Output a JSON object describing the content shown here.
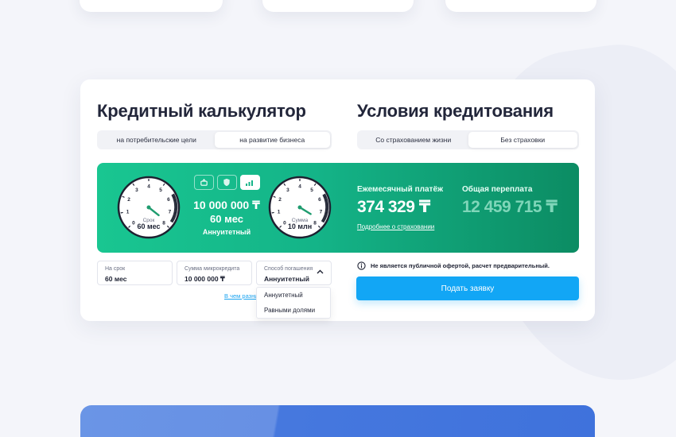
{
  "calculator": {
    "title": "Кредитный калькулятор",
    "purpose_tabs": [
      {
        "label": "на потребительские цели",
        "active": false
      },
      {
        "label": "на развитие бизнеса",
        "active": true
      }
    ],
    "term_gauge": {
      "label": "Срок",
      "value": "60 мес",
      "ticks": [
        "0",
        "1",
        "2",
        "3",
        "4",
        "5",
        "6",
        "7",
        "8"
      ],
      "needle_value": 7.8
    },
    "amount_gauge": {
      "label": "Сумма",
      "value": "10 млн",
      "ticks": [
        "0",
        "1",
        "2",
        "3",
        "4",
        "5",
        "6",
        "7",
        "8"
      ],
      "needle_value": 7.6
    },
    "summary": {
      "amount": "10 000 000 ₸",
      "term": "60 мес",
      "payment_type": "Аннуитетный",
      "icons": [
        "basket-icon",
        "shield-icon",
        "chart-icon"
      ],
      "active_icon": 2
    },
    "fields": {
      "term": {
        "label": "На срок",
        "value": "60 мес"
      },
      "amount": {
        "label": "Сумма микрокредита",
        "value": "10 000 000 ₸"
      },
      "repayment": {
        "label": "Способ погашения",
        "value": "Аннуитетный"
      }
    },
    "repayment_options": [
      "Аннуитетный",
      "Равными долями"
    ],
    "difference_link": "В чем разница?"
  },
  "conditions": {
    "title": "Условия кредитования",
    "insurance_tabs": [
      {
        "label": "Со страхованием жизни",
        "active": false
      },
      {
        "label": "Без страховки",
        "active": true
      }
    ],
    "monthly_payment_label": "Ежемесячный платёж",
    "monthly_payment_value": "374 329 ₸",
    "overpayment_label": "Общая переплата",
    "overpayment_value": "12 459 715 ₸",
    "insurance_link": "Подробнее о страховании",
    "disclaimer": "Не является публичной офертой, расчет предварительный.",
    "submit_label": "Подать заявку"
  },
  "colors": {
    "accent_green": "#14b488",
    "accent_blue": "#12a6f5",
    "overpayment_text": "#7fd6b9"
  }
}
